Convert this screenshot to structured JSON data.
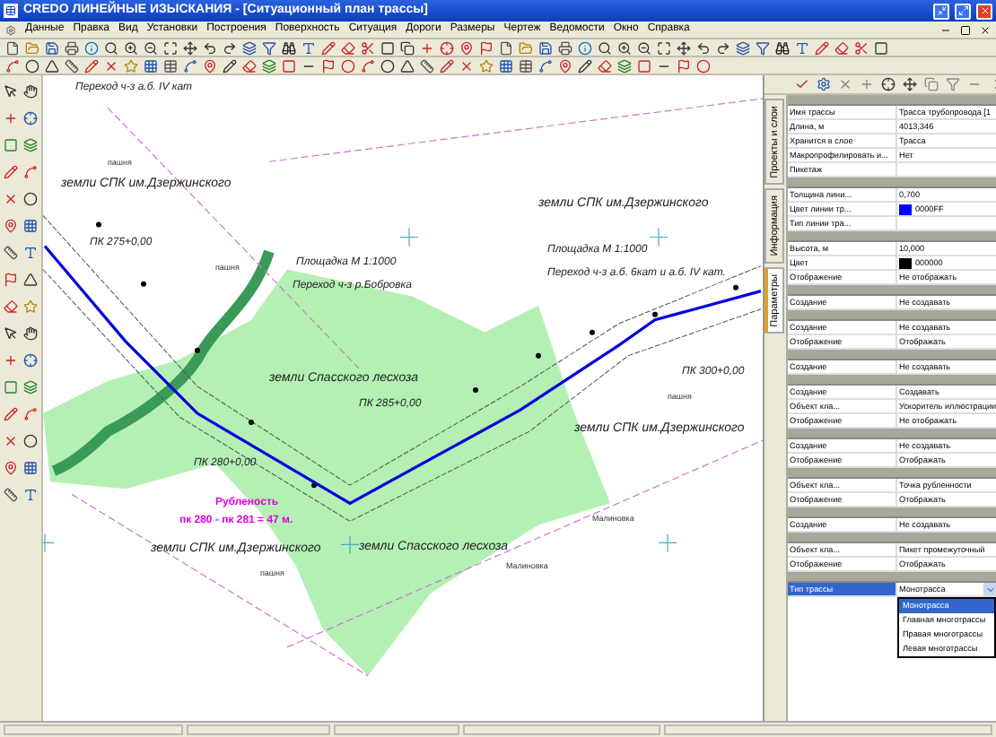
{
  "window": {
    "title": "CREDO ЛИНЕЙНЫЕ ИЗЫСКАНИЯ - [Ситуационный план трассы]"
  },
  "menu": [
    "Данные",
    "Правка",
    "Вид",
    "Установки",
    "Построения",
    "Поверхность",
    "Ситуация",
    "Дороги",
    "Размеры",
    "Чертеж",
    "Ведомости",
    "Окно",
    "Справка"
  ],
  "map": {
    "labels": [
      {
        "text": "Переход ч-з а.б. IV кат",
        "kind": "note"
      },
      {
        "text": "пашня",
        "kind": "small"
      },
      {
        "text": "земли СПК им.Дзержинского",
        "kind": "land"
      },
      {
        "text": "земли СПК им.Дзержинского",
        "kind": "land"
      },
      {
        "text": "ПК 275+0,00",
        "kind": "note"
      },
      {
        "text": "пашня",
        "kind": "small"
      },
      {
        "text": "Площадка М 1:1000",
        "kind": "note"
      },
      {
        "text": "Переход ч-з р.Бобровка",
        "kind": "note"
      },
      {
        "text": "Площадка М 1:1000",
        "kind": "note"
      },
      {
        "text": "Переход ч-з а.б. 6кат и а.б. IV кат.",
        "kind": "note"
      },
      {
        "text": "земли Спасского лесхоза",
        "kind": "land"
      },
      {
        "text": "ПК 285+0,00",
        "kind": "note"
      },
      {
        "text": "ПК 300+0,00",
        "kind": "note"
      },
      {
        "text": "пашня",
        "kind": "small"
      },
      {
        "text": "земли СПК им.Дзержинского",
        "kind": "land"
      },
      {
        "text": "ПК 280+0,00",
        "kind": "note"
      },
      {
        "text": "Рубленость",
        "kind": "alert"
      },
      {
        "text": "пк 280 - пк 281 = 47 м.",
        "kind": "alert"
      },
      {
        "text": "земли СПК им.Дзержинского",
        "kind": "land"
      },
      {
        "text": "земли Спасского лесхоза",
        "kind": "land"
      },
      {
        "text": "пашня",
        "kind": "small"
      },
      {
        "text": "Малиновка",
        "kind": "small"
      },
      {
        "text": "Малиновка",
        "kind": "small"
      }
    ]
  },
  "side_tabs": [
    {
      "label": "Проекты и слои",
      "selected": false
    },
    {
      "label": "Информация",
      "selected": false
    },
    {
      "label": "Параметры",
      "selected": true
    }
  ],
  "properties": [
    {
      "rows": [
        {
          "label": "Имя трассы",
          "value": "Трасса трубопровода [1",
          "kind": "text"
        },
        {
          "label": "Длина, м",
          "value": "4013,346",
          "kind": "text"
        },
        {
          "label": "Хранится в слое",
          "value": "Трасса",
          "kind": "text"
        },
        {
          "label": "Макропрофилировать и...",
          "value": "Нет",
          "kind": "text"
        },
        {
          "label": "Пикетаж",
          "value": "",
          "kind": "text"
        }
      ]
    },
    {
      "rows": [
        {
          "label": "Толщина лини...",
          "value": "0,700",
          "kind": "text"
        },
        {
          "label": "Цвет линии тр...",
          "value": "0000FF",
          "kind": "color",
          "color": "#0000ff"
        },
        {
          "label": "Тип линии тра...",
          "value": "",
          "kind": "text"
        }
      ]
    },
    {
      "rows": [
        {
          "label": "Высота, м",
          "value": "10,000",
          "kind": "text"
        },
        {
          "label": "Цвет",
          "value": "000000",
          "kind": "color",
          "color": "#000000"
        },
        {
          "label": "Отображение",
          "value": "Не отображать",
          "kind": "text"
        }
      ]
    },
    {
      "rows": [
        {
          "label": "Создание",
          "value": "Не создавать",
          "kind": "text"
        }
      ]
    },
    {
      "rows": [
        {
          "label": "Создание",
          "value": "Не создавать",
          "kind": "text"
        },
        {
          "label": "Отображение",
          "value": "Отображать",
          "kind": "text"
        }
      ]
    },
    {
      "rows": [
        {
          "label": "Создание",
          "value": "Не создавать",
          "kind": "text"
        }
      ]
    },
    {
      "rows": [
        {
          "label": "Создание",
          "value": "Создавать",
          "kind": "text"
        },
        {
          "label": "Объект кла...",
          "value": "Ускоритель иллюстрации",
          "kind": "text"
        },
        {
          "label": "Отображение",
          "value": "Не отображать",
          "kind": "text"
        }
      ]
    },
    {
      "rows": [
        {
          "label": "Создание",
          "value": "Не создавать",
          "kind": "text"
        },
        {
          "label": "Отображение",
          "value": "Отображать",
          "kind": "text"
        }
      ]
    },
    {
      "rows": [
        {
          "label": "Объект кла...",
          "value": "Точка рубленности",
          "kind": "text"
        },
        {
          "label": "Отображение",
          "value": "Отображать",
          "kind": "text"
        }
      ]
    },
    {
      "rows": [
        {
          "label": "Создание",
          "value": "Не создавать",
          "kind": "text"
        }
      ]
    },
    {
      "rows": [
        {
          "label": "Объект кла...",
          "value": "Пикет промежуточный",
          "kind": "text"
        },
        {
          "label": "Отображение",
          "value": "Отображать",
          "kind": "text"
        }
      ]
    },
    {
      "rows": [
        {
          "label": "Тип трассы",
          "value": "Монотрасса",
          "kind": "dropdown",
          "options": [
            {
              "label": "Монотрасса",
              "selected": true
            },
            {
              "label": "Главная многотрассы",
              "selected": false
            },
            {
              "label": "Правая многотрассы",
              "selected": false
            },
            {
              "label": "Левая многотрассы",
              "selected": false
            }
          ]
        }
      ]
    }
  ]
}
